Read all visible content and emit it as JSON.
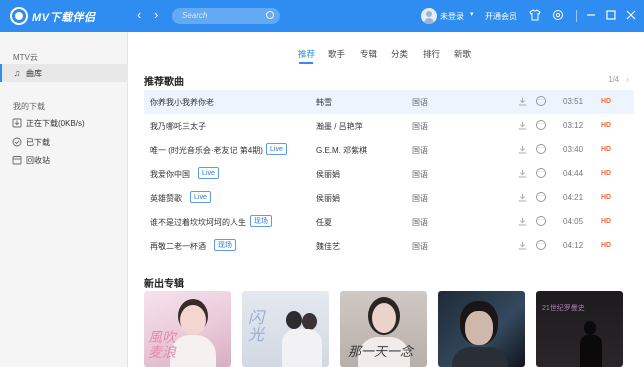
{
  "app": {
    "title": "MV下载伴侣"
  },
  "search": {
    "placeholder": "Search"
  },
  "user": {
    "login_label": "未登录",
    "vip_label": "开通会员"
  },
  "sidebar": {
    "group1": "MTV云",
    "library": "曲库",
    "group2": "我的下载",
    "downloading": "正在下载(0KB/s)",
    "downloaded": "已下载",
    "recycle": "回收站"
  },
  "tabs": [
    "推荐",
    "歌手",
    "专辑",
    "分类",
    "排行",
    "新歌"
  ],
  "recommend": {
    "title": "推荐歌曲",
    "pager": "1/4",
    "songs": [
      {
        "title": "你养我小我养你老",
        "tag": "",
        "artist": "韩雪",
        "lang": "国语",
        "duration": "03:51",
        "quality": "HD"
      },
      {
        "title": "我乃哪吒三太子",
        "tag": "",
        "artist": "瀚墨 / 吕艳萍",
        "lang": "国语",
        "duration": "03:12",
        "quality": "HD"
      },
      {
        "title": "唯一 (时光音乐会·老友记 第4期)",
        "tag": "Live",
        "artist": "G.E.M. 邓紫棋",
        "lang": "国语",
        "duration": "03:40",
        "quality": "HD"
      },
      {
        "title": "我爱你中国",
        "tag": "Live",
        "artist": "侯丽娟",
        "lang": "国语",
        "duration": "04:44",
        "quality": "HD"
      },
      {
        "title": "英雄赞歌",
        "tag": "Live",
        "artist": "侯丽娟",
        "lang": "国语",
        "duration": "04:21",
        "quality": "HD"
      },
      {
        "title": "谁不是过着坎坎坷坷的人生",
        "tag": "现场",
        "artist": "任夏",
        "lang": "国语",
        "duration": "04:05",
        "quality": "HD"
      },
      {
        "title": "再敬二老一杯酒",
        "tag": "现场",
        "artist": "魏佳艺",
        "lang": "国语",
        "duration": "04:12",
        "quality": "HD"
      }
    ]
  },
  "new_albums": {
    "title": "新出专辑",
    "covers": [
      "風吹麦浪",
      "闪光",
      "那一天一念",
      "",
      "21世纪罗曼史"
    ]
  },
  "colors": {
    "accent": "#2f8cf0",
    "hd": "#f36c3d",
    "tag": "#2f7be0",
    "highlight_row": "#eef4fe"
  },
  "icons": [
    "logo-icon",
    "back-icon",
    "forward-icon",
    "search-icon",
    "avatar-icon",
    "skin-icon",
    "settings-icon",
    "minimize-icon",
    "maximize-icon",
    "close-icon",
    "music-note-icon",
    "download-icon",
    "check-circle-icon",
    "recycle-icon",
    "more-icon"
  ]
}
